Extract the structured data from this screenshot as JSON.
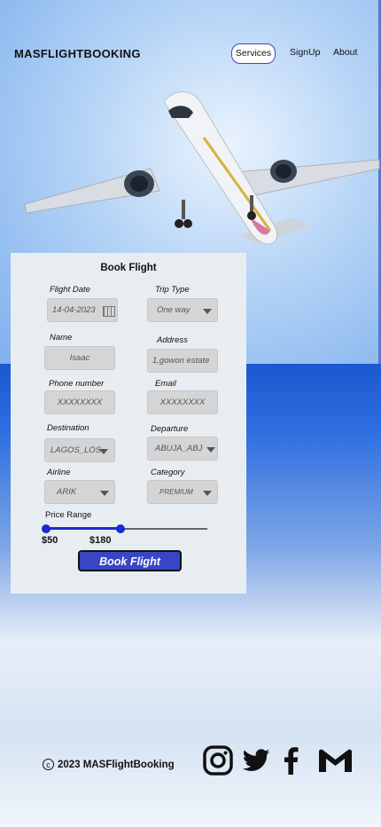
{
  "nav": {
    "brand": "MASFLIGHTBOOKING",
    "services": "Services",
    "signup": "SignUp",
    "about": "About"
  },
  "form": {
    "title": "Book Flight",
    "flight_date_label": "Flight Date",
    "flight_date_value": "14-04-2023",
    "trip_type_label": "Trip Type",
    "trip_type_value": "One way",
    "name_label": "Name",
    "name_value": "Isaac",
    "address_label": "Address",
    "address_value": "1,gowon estate",
    "phone_label": "Phone number",
    "phone_value": "XXXXXXXX",
    "email_label": "Email",
    "email_value": "XXXXXXXX",
    "destination_label": "Destination",
    "destination_value": "LAGOS_LOS",
    "departure_label": "Departure",
    "departure_value": "ABUJA_ABJ",
    "airline_label": "Airline",
    "airline_value": "ARIK",
    "category_label": "Category",
    "category_value": "PREMIUM",
    "price_label": "Price Range",
    "price_min": "$50",
    "price_max": "$180",
    "submit": "Book Flight"
  },
  "footer": {
    "copyright_symbol": "c",
    "copyright_text": "2023  MASFlightBooking"
  },
  "icons": [
    "instagram-icon",
    "twitter-icon",
    "facebook-icon",
    "gmail-icon",
    "calendar-icon",
    "chevron-down-icon"
  ],
  "colors": {
    "accent": "#3846c4",
    "slider": "#1b2ad0",
    "card": "#e8edf2"
  }
}
